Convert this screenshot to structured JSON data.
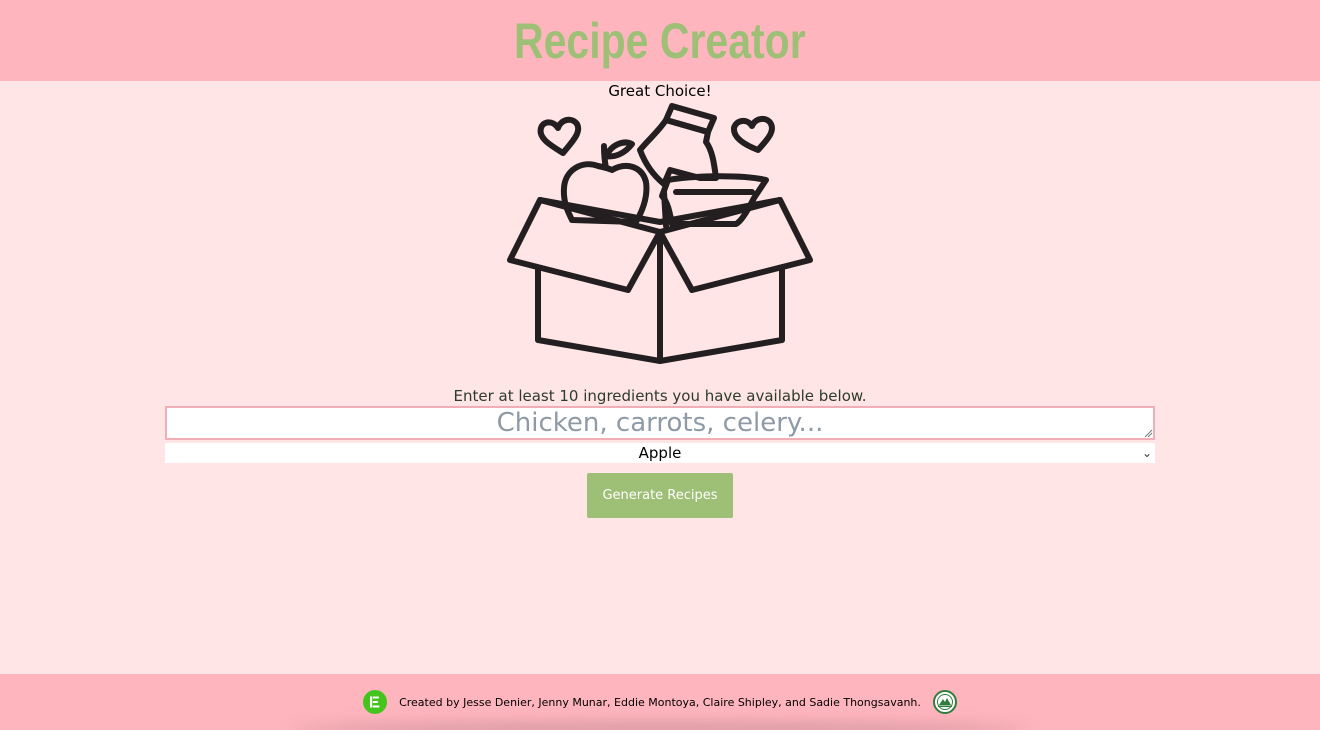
{
  "header": {
    "title": "Recipe Creator"
  },
  "main": {
    "subtitle": "Great Choice!",
    "illustration_icon": "grocery-box-with-hearts-icon",
    "instructions": "Enter at least 10 ingredients you have available below.",
    "ingredients_input": {
      "value": "",
      "placeholder": "Chicken, carrots, celery..."
    },
    "ingredient_select": {
      "selected": "Apple"
    },
    "generate_button_label": "Generate Recipes"
  },
  "footer": {
    "left_icon": "list-logo-icon",
    "credits": "Created by Jesse Denier, Jenny Munar, Eddie Montoya, Claire Shipley, and Sadie Thongsavanh.",
    "right_icon": "round-seal-logo-icon"
  },
  "colors": {
    "header_bg": "#ffb5be",
    "page_bg": "#ffe5e6",
    "accent_green": "#9dbf76",
    "input_border": "#f2aeb6"
  }
}
